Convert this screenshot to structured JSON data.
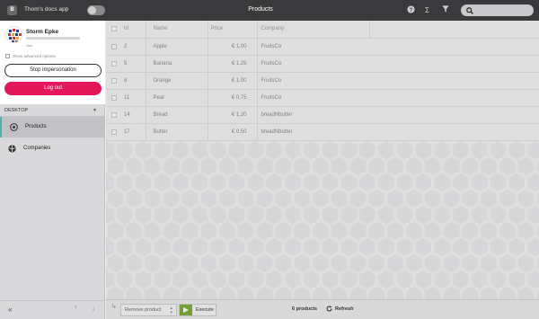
{
  "app": {
    "logo_letter": "B",
    "name": "Thom's docs app",
    "page_title": "Products"
  },
  "topbar_icons": [
    "help-icon",
    "sigma-icon",
    "filter-icon",
    "search-icon"
  ],
  "user": {
    "name": "Storm Epke",
    "role": "User",
    "advanced_label": "Show advanced options",
    "stop_label": "Stop impersonation",
    "logout_label": "Log out"
  },
  "sidebar": {
    "section": "DESKTOP",
    "items": [
      {
        "label": "Products",
        "icon": "products-icon",
        "active": true
      },
      {
        "label": "Companies",
        "icon": "companies-icon",
        "active": false
      }
    ]
  },
  "table": {
    "columns": [
      "Id",
      "Name",
      "Price",
      "Company"
    ],
    "rows": [
      {
        "id": "2",
        "name": "Apple",
        "price": "€ 1.00",
        "company": "FruitsCo"
      },
      {
        "id": "5",
        "name": "Banana",
        "price": "€ 1.25",
        "company": "FruitsCo"
      },
      {
        "id": "8",
        "name": "Orange",
        "price": "€ 1.00",
        "company": "FruitsCo"
      },
      {
        "id": "11",
        "name": "Pear",
        "price": "€ 0.75",
        "company": "FruitsCo"
      },
      {
        "id": "14",
        "name": "Bread",
        "price": "€ 1.20",
        "company": "breadNbutter"
      },
      {
        "id": "17",
        "name": "Butter",
        "price": "€ 0.50",
        "company": "breadNbutter"
      }
    ]
  },
  "toolbar": {
    "action": "Remove product",
    "execute_label": "Execute",
    "count": "6 products",
    "refresh_label": "Refresh"
  },
  "colors": {
    "topbar": "#3a3a3c",
    "accent": "#4ab3b3",
    "logout": "#e3175a",
    "execute": "#78a833"
  }
}
